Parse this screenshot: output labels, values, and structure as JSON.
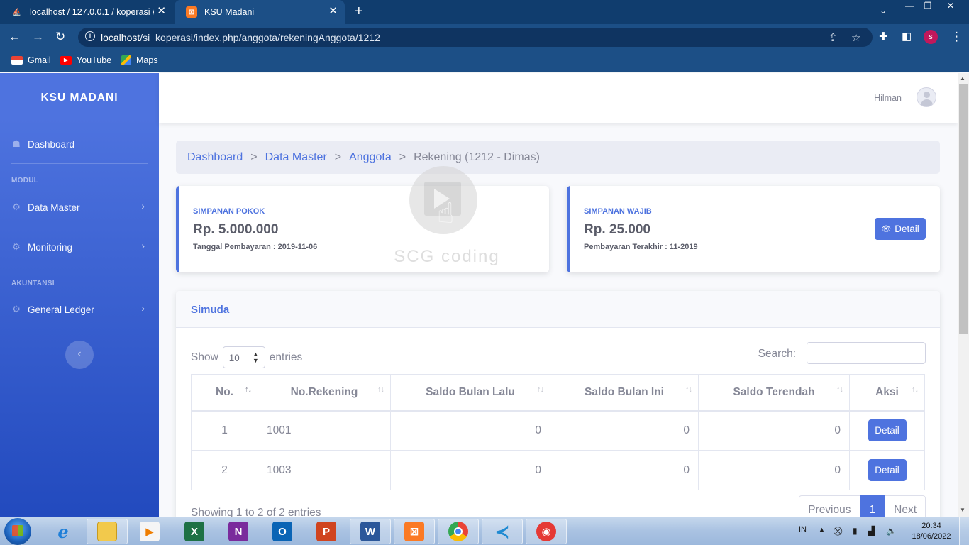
{
  "browser": {
    "tabs": [
      {
        "title": "localhost / 127.0.0.1 / koperasi / ",
        "active": false
      },
      {
        "title": "KSU Madani",
        "active": true
      }
    ],
    "url_host": "localhost",
    "url_path": "/si_koperasi/index.php/anggota/rekeningAnggota/1212",
    "profile_initial": "s",
    "bookmarks": [
      "Gmail",
      "YouTube",
      "Maps"
    ]
  },
  "sidebar": {
    "brand": "KSU MADANI",
    "dashboard": "Dashboard",
    "heading_modul": "MODUL",
    "data_master": "Data Master",
    "monitoring": "Monitoring",
    "heading_akuntansi": "AKUNTANSI",
    "general_ledger": "General Ledger"
  },
  "topbar": {
    "username": "Hilman"
  },
  "breadcrumb": {
    "items": [
      "Dashboard",
      "Data Master",
      "Anggota"
    ],
    "separator": ">",
    "active": "Rekening (1212 - Dimas)"
  },
  "cards": {
    "pokok": {
      "label": "SIMPANAN POKOK",
      "amount": "Rp. 5.000.000",
      "sub": "Tanggal Pembayaran : 2019-11-06"
    },
    "wajib": {
      "label": "SIMPANAN WAJIB",
      "amount": "Rp. 25.000",
      "sub": "Pembayaran Terakhir : 11-2019",
      "button": "Detail"
    }
  },
  "watermark": "SCG coding",
  "simuda": {
    "title": "Simuda",
    "show_label": "Show",
    "entries_value": "10",
    "entries_label": "entries",
    "search_label": "Search:",
    "columns": [
      "No.",
      "No.Rekening",
      "Saldo Bulan Lalu",
      "Saldo Bulan Ini",
      "Saldo Terendah",
      "Aksi"
    ],
    "rows": [
      {
        "no": "1",
        "rekening": "1001",
        "lalu": "0",
        "ini": "0",
        "terendah": "0",
        "aksi": "Detail"
      },
      {
        "no": "2",
        "rekening": "1003",
        "lalu": "0",
        "ini": "0",
        "terendah": "0",
        "aksi": "Detail"
      }
    ],
    "showing": "Showing 1 to 2 of 2 entries",
    "pager": {
      "previous": "Previous",
      "page": "1",
      "next": "Next"
    }
  },
  "taskbar": {
    "language": "IN",
    "time": "20:34",
    "date": "18/06/2022"
  },
  "colors": {
    "primary": "#4e73df",
    "sidebar_top": "#4e73df",
    "sidebar_bottom": "#224abe",
    "browser_frame": "#1c4f86"
  }
}
